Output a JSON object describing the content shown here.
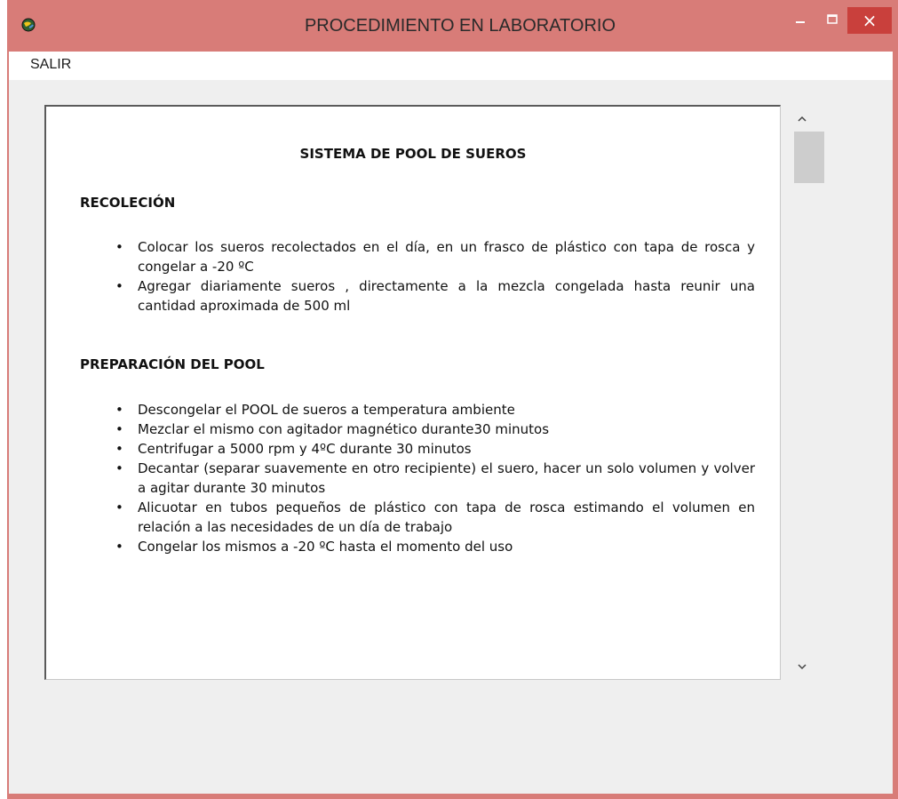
{
  "window": {
    "title": "PROCEDIMIENTO EN LABORATORIO",
    "close_symbol": "×",
    "icons": [
      "app-globe-icon",
      "minimize-icon",
      "maximize-icon",
      "close-icon"
    ]
  },
  "menu": {
    "items": [
      "SALIR"
    ]
  },
  "document": {
    "title": "SISTEMA DE POOL DE SUEROS",
    "sections": [
      {
        "heading": "RECOLECIÓN",
        "items": [
          "Colocar los sueros recolectados en el día, en un frasco de plástico con tapa de rosca y congelar a -20 ºC",
          "Agregar diariamente sueros , directamente  a la mezcla congelada hasta reunir una cantidad aproximada de 500 ml"
        ]
      },
      {
        "heading": "PREPARACIÓN DEL POOL",
        "items": [
          "Descongelar el POOL de sueros a temperatura ambiente",
          "Mezclar el mismo con agitador magnético durante30 minutos",
          "Centrifugar a 5000 rpm y 4ºC durante 30 minutos",
          "Decantar (separar suavemente en otro recipiente) el suero, hacer un solo volumen y volver a agitar durante 30 minutos",
          "Alicuotar en tubos pequeños de plástico con tapa de rosca estimando el volumen en relación a las necesidades de un día de trabajo",
          "Congelar los mismos a -20 ºC hasta el momento del uso"
        ]
      }
    ]
  },
  "scrollbar": {
    "icons": [
      "chevron-up-icon",
      "chevron-down-icon"
    ]
  },
  "colors": {
    "titlebar": "#d87c78",
    "close_button": "#c9403c",
    "client_bg": "#efefef",
    "scroll_thumb": "#cdcdcd"
  }
}
